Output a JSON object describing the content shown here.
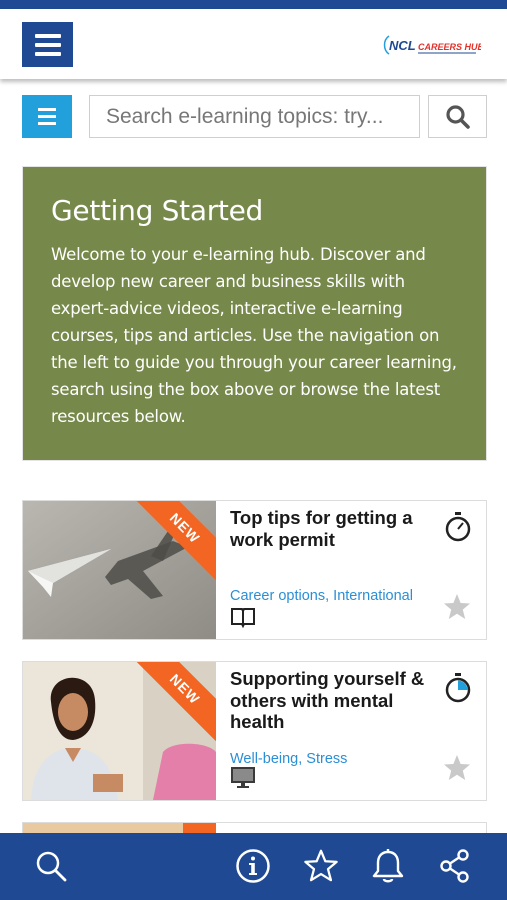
{
  "header": {
    "logo_ncl": "NCL",
    "logo_careers": "CAREERS HUB"
  },
  "search": {
    "placeholder": "Search e-learning topics: try..."
  },
  "getting_started": {
    "title": "Getting Started",
    "body": "Welcome to your e-learning hub. Discover and develop new career and business skills with expert-advice videos, interactive e-learning courses, tips and articles. Use the navigation on the left to guide you through your career learning, search using the box above or browse the latest resources below."
  },
  "cards": [
    {
      "badge": "NEW",
      "title": "Top tips for getting a work permit",
      "tags": "Career options, International",
      "type_icon": "book-icon",
      "timer_progress": 0
    },
    {
      "badge": "NEW",
      "title": "Supporting yourself & others with mental health",
      "tags": "Well-being, Stress",
      "type_icon": "monitor-icon",
      "timer_progress": 0.25
    }
  ],
  "bottom_nav": [
    "search-icon",
    "info-icon",
    "star-icon",
    "bell-icon",
    "share-icon"
  ],
  "colors": {
    "brand_blue": "#1f4a93",
    "accent_blue": "#22a0dc",
    "green_panel": "#76894a",
    "new_orange": "#f26522",
    "tag_blue": "#2a8fd6"
  }
}
